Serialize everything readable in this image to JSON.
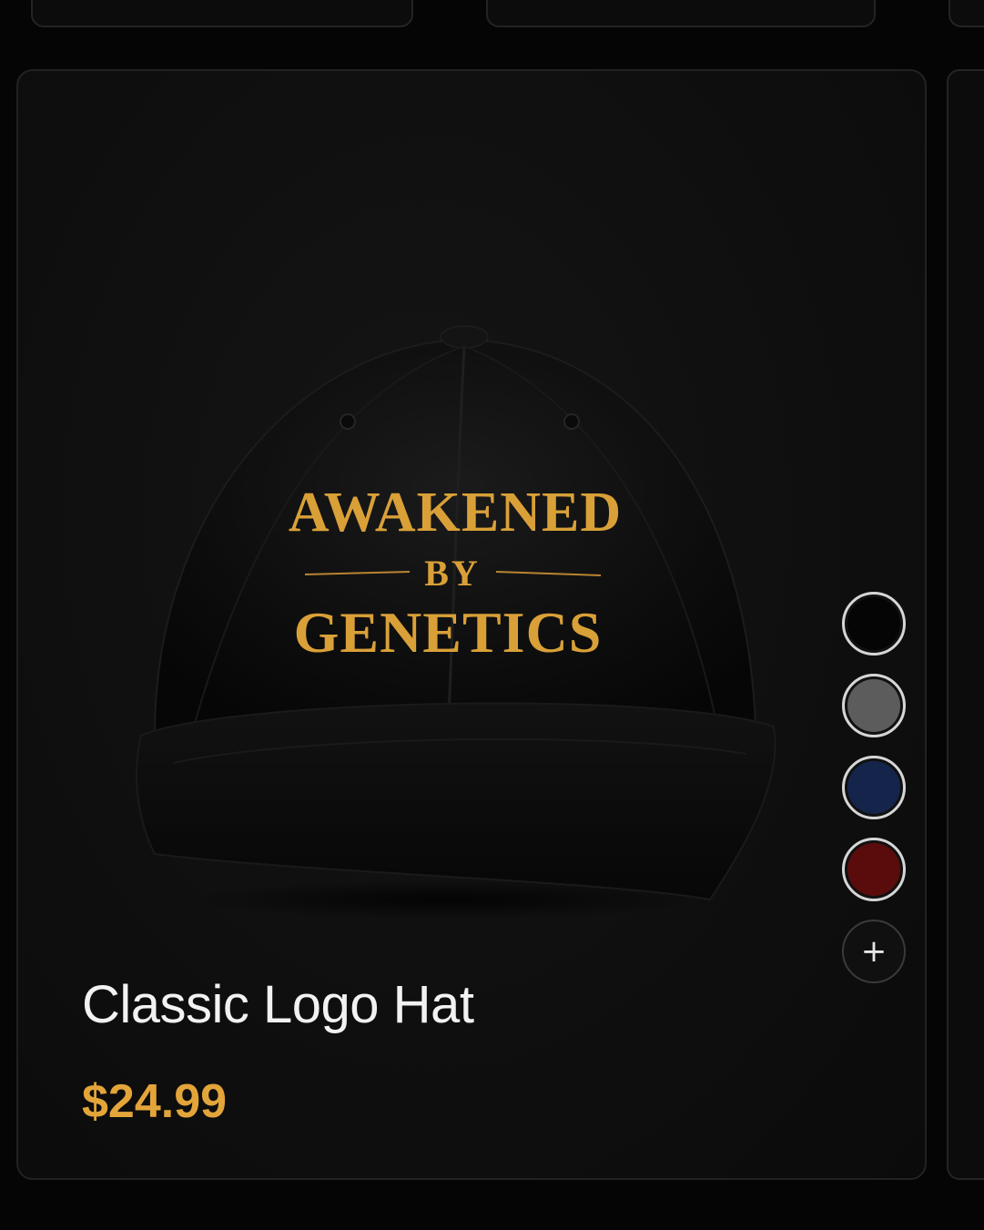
{
  "product": {
    "name": "Classic Logo Hat",
    "price": "$24.99",
    "embroidery": {
      "line1": "AWAKENED",
      "line2": "BY",
      "line3": "GENETICS"
    }
  },
  "colors": {
    "accent_gold": "#e3a53a",
    "embroidery_gold": "#d9a038",
    "card_bg": "#0f0f0f"
  },
  "swatches": [
    {
      "name": "black",
      "hex": "#050505"
    },
    {
      "name": "gray",
      "hex": "#5c5c5c"
    },
    {
      "name": "navy",
      "hex": "#14244a"
    },
    {
      "name": "maroon",
      "hex": "#5a0c0c"
    }
  ],
  "more_colors_icon": "plus-icon",
  "more_colors_symbol": "+"
}
